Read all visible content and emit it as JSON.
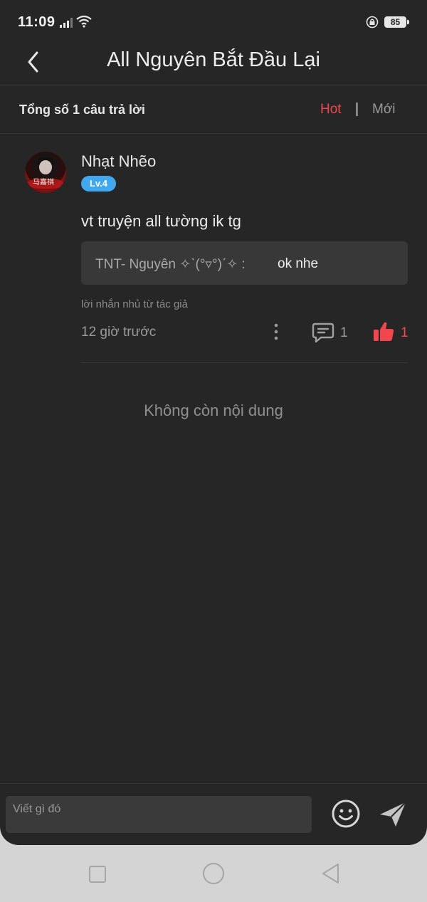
{
  "status_bar": {
    "time": "11:09",
    "battery": "85"
  },
  "header": {
    "title": "All Nguyên Bắt Đầu Lại"
  },
  "subheader": {
    "total": "Tổng số 1 câu trả lời",
    "sort_hot": "Hot",
    "separator": "|",
    "sort_new": "Mới"
  },
  "comment": {
    "username": "Nhạt Nhẽo",
    "level": "Lv.4",
    "avatar_text": "马嘉祺",
    "text": "vt truyện all tường ik tg",
    "reply_author": "TNT- Nguyên ✧ˋ(°▿°)ˊ✧ :",
    "reply_text": "ok nhe",
    "author_note": "lời nhắn nhủ từ tác giả",
    "timestamp": "12 giờ trước",
    "reply_count": "1",
    "like_count": "1"
  },
  "end_message": "Không còn nội dung",
  "input": {
    "placeholder": "Viết gì đó"
  },
  "colors": {
    "accent": "#f0474f",
    "level_badge": "#41a8ef",
    "background": "#262626"
  }
}
